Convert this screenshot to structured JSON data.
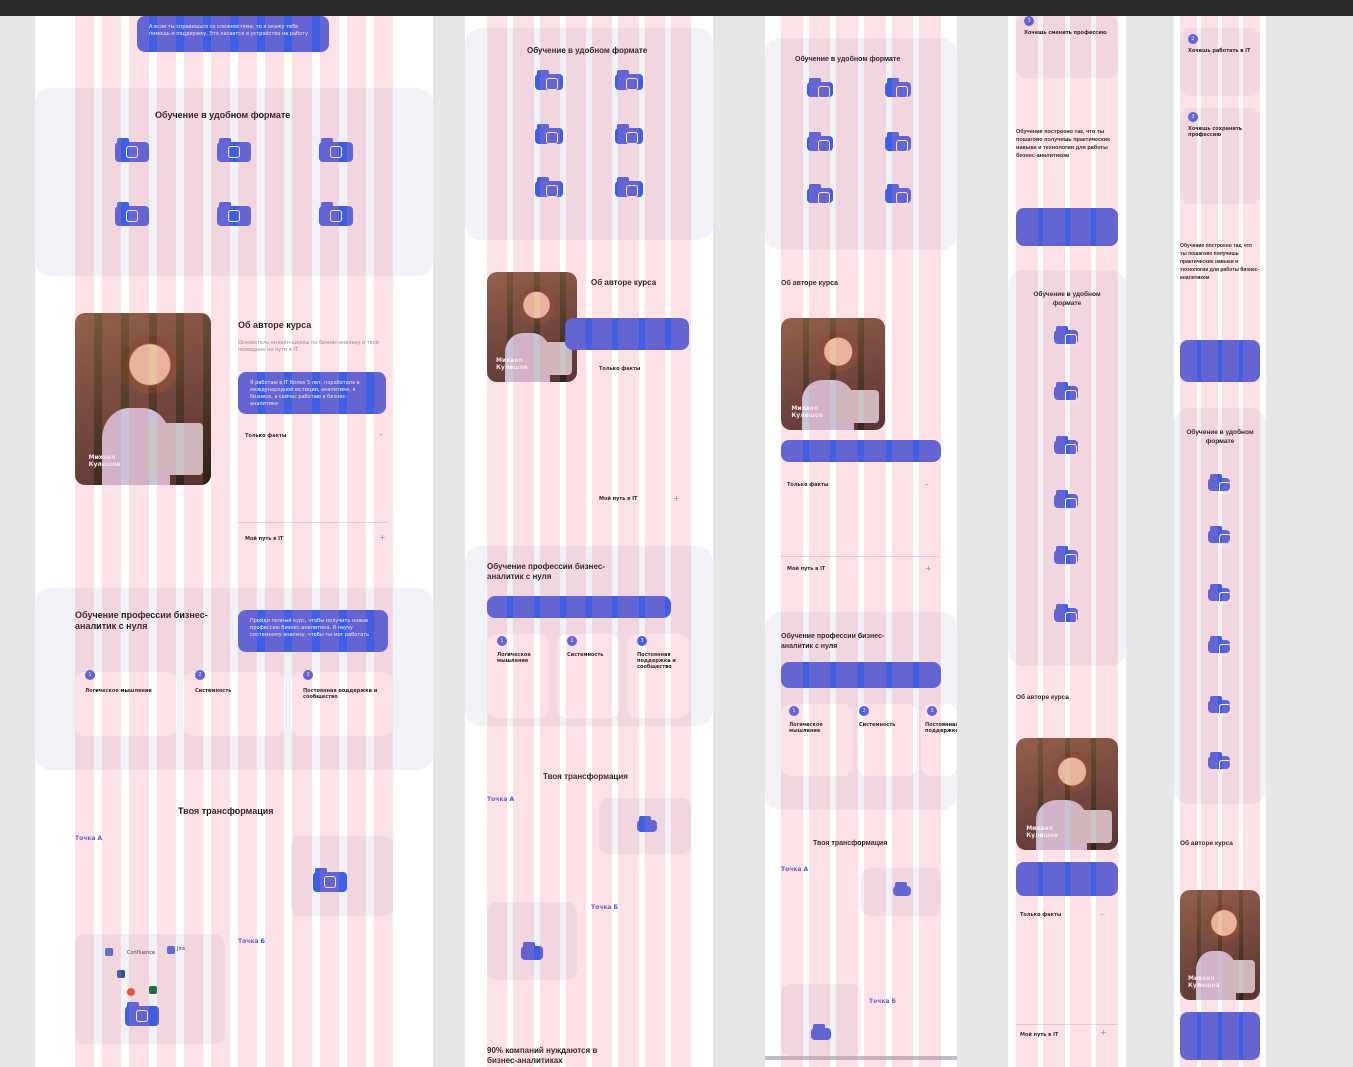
{
  "frames": {
    "f1": {
      "quote_top": "А если ты справишься со сложностями, то я окажу тебе помощь и поддержку. Это касается и устройства на работу",
      "format_title": "Обучение в удобном формате",
      "author_title": "Об авторе курса",
      "author_sub": "Основатель онлайн-школы по бизнес-анализу и твой помощник на пути в IT",
      "author_quote": "Я работаю в IT более 5 лет, поработала в международной юстиции, аналитике, в бизнесе, а сейчас работаю в бизнес-аналитике",
      "facts_label": "Только факты",
      "path_label": "Мой путь в IT",
      "photo_caption": "Михаил Кулешов",
      "profession_title": "Обучение профессии бизнес-аналитик с нуля",
      "profession_quote": "Пройди полный курс, чтобы получить новые профессию бизнес-аналитика. Я научу системному анализу, чтобы ты мог работать",
      "card1": "Логическое мышление",
      "card2": "Системность",
      "card3": "Постоянная поддержка и сообщество",
      "transform_title": "Твоя трансформация",
      "point_a": "Точка А",
      "point_b": "Точка Б",
      "confluence": "Confluence",
      "jira": "Jira"
    },
    "f2": {
      "format_title": "Обучение в удобном формате",
      "author_title": "Об авторе курса",
      "facts_label": "Только факты",
      "path_label": "Мой путь в IT",
      "photo_caption": "Михаил Кулешов",
      "profession_title": "Обучение профессии бизнес-аналитик с нуля",
      "card1": "Логическое мышление",
      "card2": "Системность",
      "card3": "Постоянная поддержка и сообщество",
      "transform_title": "Твоя трансформация",
      "point_a": "Точка А",
      "point_b": "Точка Б",
      "demand_title": "90% компаний нуждаются в бизнес-аналитиках"
    },
    "f3": {
      "format_title": "Обучение в удобном формате",
      "author_title": "Об авторе курса",
      "facts_label": "Только факты",
      "path_label": "Мой путь в IT",
      "photo_caption": "Михаил Кулешов",
      "profession_title": "Обучение профессии бизнес-аналитик с нуля",
      "card1": "Логическое мышление",
      "card2": "Системность",
      "card3": "Постоянная поддержка",
      "transform_title": "Твоя трансформация",
      "point_a": "Точка А",
      "point_b": "Точка Б"
    },
    "f4": {
      "change_prof": "Хочешь сменить профессию",
      "built_title": "Обучение построено так, что ты пошагово получишь практические навыки и технологии для работы бизнес-аналитиком",
      "format_title": "Обучение в удобном формате",
      "author_title": "Об авторе курса",
      "facts_label": "Только факты",
      "path_label": "Мой путь в IT",
      "photo_caption": "Михаил Кулешов"
    },
    "f5": {
      "work_it": "Хочешь работать в IT",
      "raise": "Хочешь сохранить профессию",
      "built_title": "Обучение построено так, что ты пошагово получишь практические навыки и технологии для работы бизнес-аналитиком",
      "format_title": "Обучение в удобном формате",
      "author_title": "Об авторе курса",
      "photo_caption": "Михаил Кулешов"
    }
  },
  "colors": {
    "accent": "#3d5fe6",
    "panel": "#f1f1f8",
    "grid": "#f0788c"
  }
}
